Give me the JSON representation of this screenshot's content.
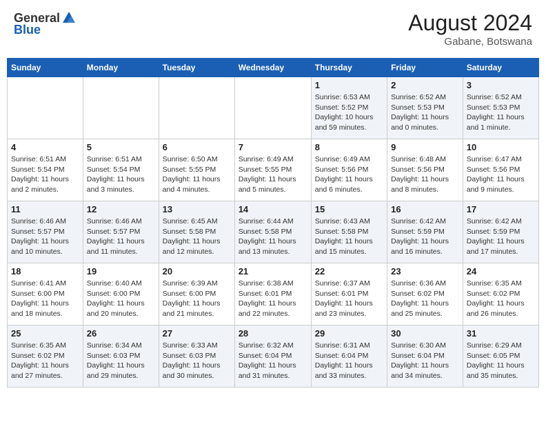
{
  "header": {
    "logo_general": "General",
    "logo_blue": "Blue",
    "month_year": "August 2024",
    "location": "Gabane, Botswana"
  },
  "days_of_week": [
    "Sunday",
    "Monday",
    "Tuesday",
    "Wednesday",
    "Thursday",
    "Friday",
    "Saturday"
  ],
  "weeks": [
    [
      {
        "day": "",
        "info": ""
      },
      {
        "day": "",
        "info": ""
      },
      {
        "day": "",
        "info": ""
      },
      {
        "day": "",
        "info": ""
      },
      {
        "day": "1",
        "sunrise": "Sunrise: 6:53 AM",
        "sunset": "Sunset: 5:52 PM",
        "daylight": "Daylight: 10 hours and 59 minutes."
      },
      {
        "day": "2",
        "sunrise": "Sunrise: 6:52 AM",
        "sunset": "Sunset: 5:53 PM",
        "daylight": "Daylight: 11 hours and 0 minutes."
      },
      {
        "day": "3",
        "sunrise": "Sunrise: 6:52 AM",
        "sunset": "Sunset: 5:53 PM",
        "daylight": "Daylight: 11 hours and 1 minute."
      }
    ],
    [
      {
        "day": "4",
        "sunrise": "Sunrise: 6:51 AM",
        "sunset": "Sunset: 5:54 PM",
        "daylight": "Daylight: 11 hours and 2 minutes."
      },
      {
        "day": "5",
        "sunrise": "Sunrise: 6:51 AM",
        "sunset": "Sunset: 5:54 PM",
        "daylight": "Daylight: 11 hours and 3 minutes."
      },
      {
        "day": "6",
        "sunrise": "Sunrise: 6:50 AM",
        "sunset": "Sunset: 5:55 PM",
        "daylight": "Daylight: 11 hours and 4 minutes."
      },
      {
        "day": "7",
        "sunrise": "Sunrise: 6:49 AM",
        "sunset": "Sunset: 5:55 PM",
        "daylight": "Daylight: 11 hours and 5 minutes."
      },
      {
        "day": "8",
        "sunrise": "Sunrise: 6:49 AM",
        "sunset": "Sunset: 5:56 PM",
        "daylight": "Daylight: 11 hours and 6 minutes."
      },
      {
        "day": "9",
        "sunrise": "Sunrise: 6:48 AM",
        "sunset": "Sunset: 5:56 PM",
        "daylight": "Daylight: 11 hours and 8 minutes."
      },
      {
        "day": "10",
        "sunrise": "Sunrise: 6:47 AM",
        "sunset": "Sunset: 5:56 PM",
        "daylight": "Daylight: 11 hours and 9 minutes."
      }
    ],
    [
      {
        "day": "11",
        "sunrise": "Sunrise: 6:46 AM",
        "sunset": "Sunset: 5:57 PM",
        "daylight": "Daylight: 11 hours and 10 minutes."
      },
      {
        "day": "12",
        "sunrise": "Sunrise: 6:46 AM",
        "sunset": "Sunset: 5:57 PM",
        "daylight": "Daylight: 11 hours and 11 minutes."
      },
      {
        "day": "13",
        "sunrise": "Sunrise: 6:45 AM",
        "sunset": "Sunset: 5:58 PM",
        "daylight": "Daylight: 11 hours and 12 minutes."
      },
      {
        "day": "14",
        "sunrise": "Sunrise: 6:44 AM",
        "sunset": "Sunset: 5:58 PM",
        "daylight": "Daylight: 11 hours and 13 minutes."
      },
      {
        "day": "15",
        "sunrise": "Sunrise: 6:43 AM",
        "sunset": "Sunset: 5:58 PM",
        "daylight": "Daylight: 11 hours and 15 minutes."
      },
      {
        "day": "16",
        "sunrise": "Sunrise: 6:42 AM",
        "sunset": "Sunset: 5:59 PM",
        "daylight": "Daylight: 11 hours and 16 minutes."
      },
      {
        "day": "17",
        "sunrise": "Sunrise: 6:42 AM",
        "sunset": "Sunset: 5:59 PM",
        "daylight": "Daylight: 11 hours and 17 minutes."
      }
    ],
    [
      {
        "day": "18",
        "sunrise": "Sunrise: 6:41 AM",
        "sunset": "Sunset: 6:00 PM",
        "daylight": "Daylight: 11 hours and 18 minutes."
      },
      {
        "day": "19",
        "sunrise": "Sunrise: 6:40 AM",
        "sunset": "Sunset: 6:00 PM",
        "daylight": "Daylight: 11 hours and 20 minutes."
      },
      {
        "day": "20",
        "sunrise": "Sunrise: 6:39 AM",
        "sunset": "Sunset: 6:00 PM",
        "daylight": "Daylight: 11 hours and 21 minutes."
      },
      {
        "day": "21",
        "sunrise": "Sunrise: 6:38 AM",
        "sunset": "Sunset: 6:01 PM",
        "daylight": "Daylight: 11 hours and 22 minutes."
      },
      {
        "day": "22",
        "sunrise": "Sunrise: 6:37 AM",
        "sunset": "Sunset: 6:01 PM",
        "daylight": "Daylight: 11 hours and 23 minutes."
      },
      {
        "day": "23",
        "sunrise": "Sunrise: 6:36 AM",
        "sunset": "Sunset: 6:02 PM",
        "daylight": "Daylight: 11 hours and 25 minutes."
      },
      {
        "day": "24",
        "sunrise": "Sunrise: 6:35 AM",
        "sunset": "Sunset: 6:02 PM",
        "daylight": "Daylight: 11 hours and 26 minutes."
      }
    ],
    [
      {
        "day": "25",
        "sunrise": "Sunrise: 6:35 AM",
        "sunset": "Sunset: 6:02 PM",
        "daylight": "Daylight: 11 hours and 27 minutes."
      },
      {
        "day": "26",
        "sunrise": "Sunrise: 6:34 AM",
        "sunset": "Sunset: 6:03 PM",
        "daylight": "Daylight: 11 hours and 29 minutes."
      },
      {
        "day": "27",
        "sunrise": "Sunrise: 6:33 AM",
        "sunset": "Sunset: 6:03 PM",
        "daylight": "Daylight: 11 hours and 30 minutes."
      },
      {
        "day": "28",
        "sunrise": "Sunrise: 6:32 AM",
        "sunset": "Sunset: 6:04 PM",
        "daylight": "Daylight: 11 hours and 31 minutes."
      },
      {
        "day": "29",
        "sunrise": "Sunrise: 6:31 AM",
        "sunset": "Sunset: 6:04 PM",
        "daylight": "Daylight: 11 hours and 33 minutes."
      },
      {
        "day": "30",
        "sunrise": "Sunrise: 6:30 AM",
        "sunset": "Sunset: 6:04 PM",
        "daylight": "Daylight: 11 hours and 34 minutes."
      },
      {
        "day": "31",
        "sunrise": "Sunrise: 6:29 AM",
        "sunset": "Sunset: 6:05 PM",
        "daylight": "Daylight: 11 hours and 35 minutes."
      }
    ]
  ]
}
